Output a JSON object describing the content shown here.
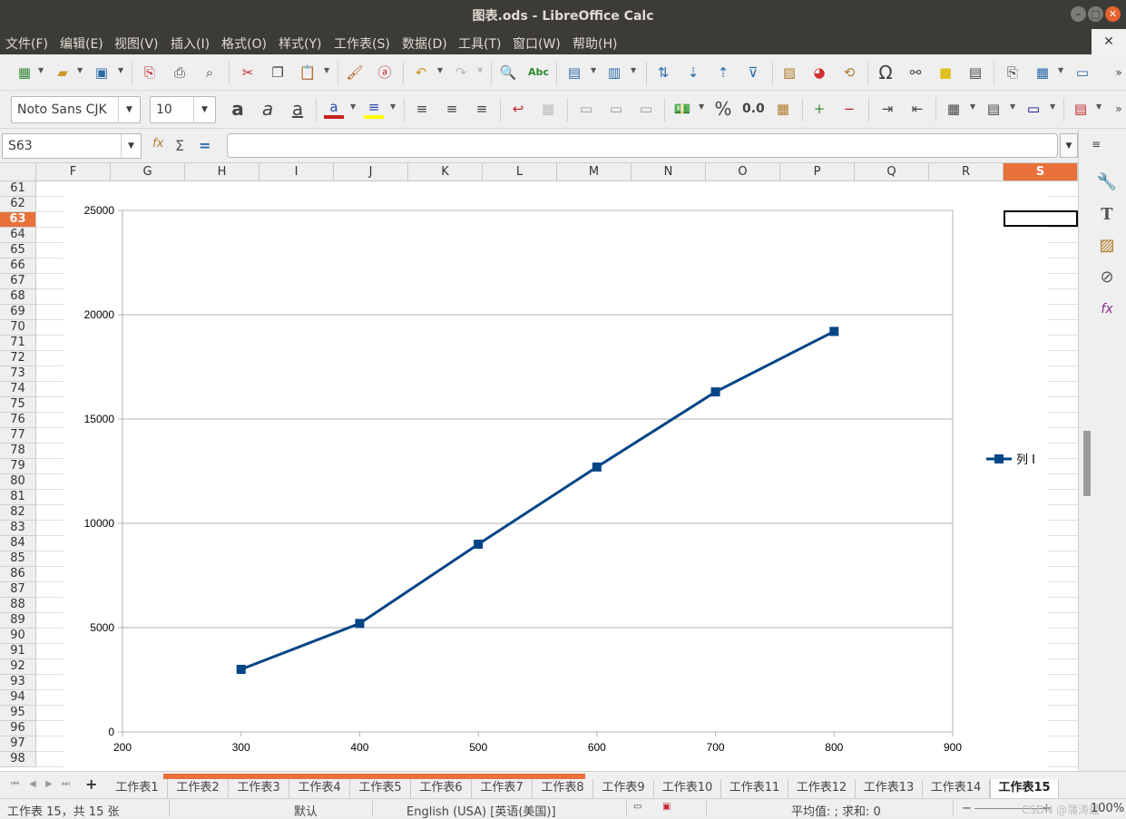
{
  "window": {
    "title": "图表.ods - LibreOffice Calc"
  },
  "menu": [
    "文件(F)",
    "编辑(E)",
    "视图(V)",
    "插入(I)",
    "格式(O)",
    "样式(Y)",
    "工作表(S)",
    "数据(D)",
    "工具(T)",
    "窗口(W)",
    "帮助(H)"
  ],
  "format_toolbar": {
    "font_name": "Noto Sans CJK",
    "font_size": "10",
    "percent_label": "%",
    "number_label": "0.0"
  },
  "formula_bar": {
    "name_box": "S63",
    "formula": ""
  },
  "columns": [
    "F",
    "G",
    "H",
    "I",
    "J",
    "K",
    "L",
    "M",
    "N",
    "O",
    "P",
    "Q",
    "R",
    "S"
  ],
  "selected_column": "S",
  "rows": [
    "61",
    "62",
    "63",
    "64",
    "65",
    "66",
    "67",
    "68",
    "69",
    "70",
    "71",
    "72",
    "73",
    "74",
    "75",
    "76",
    "77",
    "78",
    "79",
    "80",
    "81",
    "82",
    "83",
    "84",
    "85",
    "86",
    "87",
    "88",
    "89",
    "90",
    "91",
    "92",
    "93",
    "94",
    "95",
    "96",
    "97",
    "98"
  ],
  "selected_row": "63",
  "chart_data": {
    "type": "line",
    "series": [
      {
        "name": "列 I",
        "x": [
          300,
          400,
          500,
          600,
          700,
          800
        ],
        "values": [
          3000,
          5200,
          9000,
          12700,
          16300,
          19200
        ]
      }
    ],
    "xlim": [
      200,
      900
    ],
    "ylim": [
      0,
      25000
    ],
    "x_ticks": [
      "200",
      "300",
      "400",
      "500",
      "600",
      "700",
      "800",
      "900"
    ],
    "y_ticks": [
      "0",
      "5000",
      "10000",
      "15000",
      "20000",
      "25000"
    ],
    "grid": "horizontal",
    "legend_position": "right",
    "line_color": "#004586",
    "marker": "square"
  },
  "sheet_tabs": [
    "工作表1",
    "工作表2",
    "工作表3",
    "工作表4",
    "工作表5",
    "工作表6",
    "工作表7",
    "工作表8",
    "工作表9",
    "工作表10",
    "工作表11",
    "工作表12",
    "工作表13",
    "工作表14",
    "工作表15"
  ],
  "active_tab": "工作表15",
  "status": {
    "sheet_info": "工作表 15，共 15 张",
    "page_style": "默认",
    "language": "English (USA) [英语(美国)]",
    "summary": "平均值: ; 求和: 0",
    "zoom": "100%",
    "watermark": "CSDN @蒲涛最"
  },
  "colors": {
    "accent": "#e8713c",
    "series": "#004586",
    "titlebar": "#3c3b37"
  }
}
